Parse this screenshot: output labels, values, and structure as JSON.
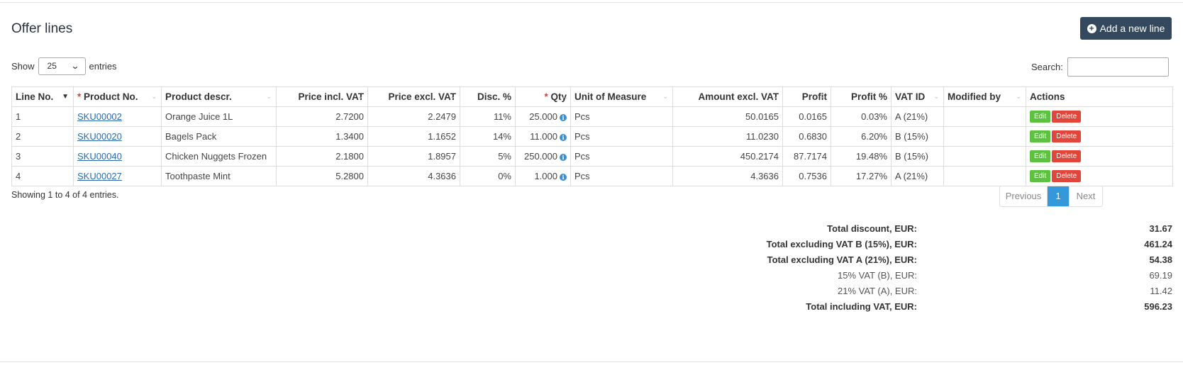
{
  "header": {
    "title": "Offer lines",
    "add_button_label": "Add a new line"
  },
  "length_control": {
    "show_label": "Show",
    "selected": "25",
    "entries_label": "entries"
  },
  "search": {
    "label": "Search:",
    "value": ""
  },
  "table": {
    "columns": [
      {
        "label": "Line No.",
        "required": false
      },
      {
        "label": "Product No.",
        "required": true
      },
      {
        "label": "Product descr.",
        "required": false
      },
      {
        "label": "Price incl. VAT",
        "required": false
      },
      {
        "label": "Price excl. VAT",
        "required": false
      },
      {
        "label": "Disc. %",
        "required": false
      },
      {
        "label": "Qty",
        "required": true
      },
      {
        "label": "Unit of Measure",
        "required": false
      },
      {
        "label": "Amount excl. VAT",
        "required": false
      },
      {
        "label": "Profit",
        "required": false
      },
      {
        "label": "Profit %",
        "required": false
      },
      {
        "label": "VAT ID",
        "required": false
      },
      {
        "label": "Modified by",
        "required": false
      },
      {
        "label": "Actions",
        "required": false
      }
    ],
    "rows": [
      {
        "line": "1",
        "sku": "SKU00002",
        "descr": "Orange Juice 1L",
        "price_incl": "2.7200",
        "price_excl": "2.2479",
        "disc": "11%",
        "qty": "25.000",
        "uom": "Pcs",
        "amount": "50.0165",
        "profit": "0.0165",
        "profit_pct": "0.03%",
        "vat_id": "A (21%)",
        "modified_by": "",
        "edit": "Edit",
        "delete": "Delete"
      },
      {
        "line": "2",
        "sku": "SKU00020",
        "descr": "Bagels Pack",
        "price_incl": "1.3400",
        "price_excl": "1.1652",
        "disc": "14%",
        "qty": "11.000",
        "uom": "Pcs",
        "amount": "11.0230",
        "profit": "0.6830",
        "profit_pct": "6.20%",
        "vat_id": "B (15%)",
        "modified_by": "",
        "edit": "Edit",
        "delete": "Delete"
      },
      {
        "line": "3",
        "sku": "SKU00040",
        "descr": "Chicken Nuggets Frozen",
        "price_incl": "2.1800",
        "price_excl": "1.8957",
        "disc": "5%",
        "qty": "250.000",
        "uom": "Pcs",
        "amount": "450.2174",
        "profit": "87.7174",
        "profit_pct": "19.48%",
        "vat_id": "B (15%)",
        "modified_by": "",
        "edit": "Edit",
        "delete": "Delete"
      },
      {
        "line": "4",
        "sku": "SKU00027",
        "descr": "Toothpaste Mint",
        "price_incl": "5.2800",
        "price_excl": "4.3636",
        "disc": "0%",
        "qty": "1.000",
        "uom": "Pcs",
        "amount": "4.3636",
        "profit": "0.7536",
        "profit_pct": "17.27%",
        "vat_id": "A (21%)",
        "modified_by": "",
        "edit": "Edit",
        "delete": "Delete"
      }
    ]
  },
  "info": "Showing 1 to 4 of 4 entries.",
  "pagination": {
    "previous": "Previous",
    "current": "1",
    "next": "Next"
  },
  "totals": [
    {
      "label": "Total discount, EUR:",
      "value": "31.67",
      "bold": true
    },
    {
      "label": "Total excluding VAT B (15%), EUR:",
      "value": "461.24",
      "bold": true
    },
    {
      "label": "Total excluding VAT A (21%), EUR:",
      "value": "54.38",
      "bold": true
    },
    {
      "label": "15% VAT (B), EUR:",
      "value": "69.19",
      "bold": false
    },
    {
      "label": "21% VAT (A), EUR:",
      "value": "11.42",
      "bold": false
    },
    {
      "label": "Total including VAT, EUR:",
      "value": "596.23",
      "bold": true
    }
  ],
  "icons": {
    "add": "plus-circle-icon",
    "info": "info-circle-icon",
    "sort": "sort-caret-icon",
    "dropdown": "chevron-down-icon"
  },
  "colors": {
    "primary_button": "#34495e",
    "edit_button": "#5cc23f",
    "delete_button": "#e2463a",
    "active_page": "#3498db",
    "link": "#2b6cb0",
    "required_marker": "#e53935"
  }
}
